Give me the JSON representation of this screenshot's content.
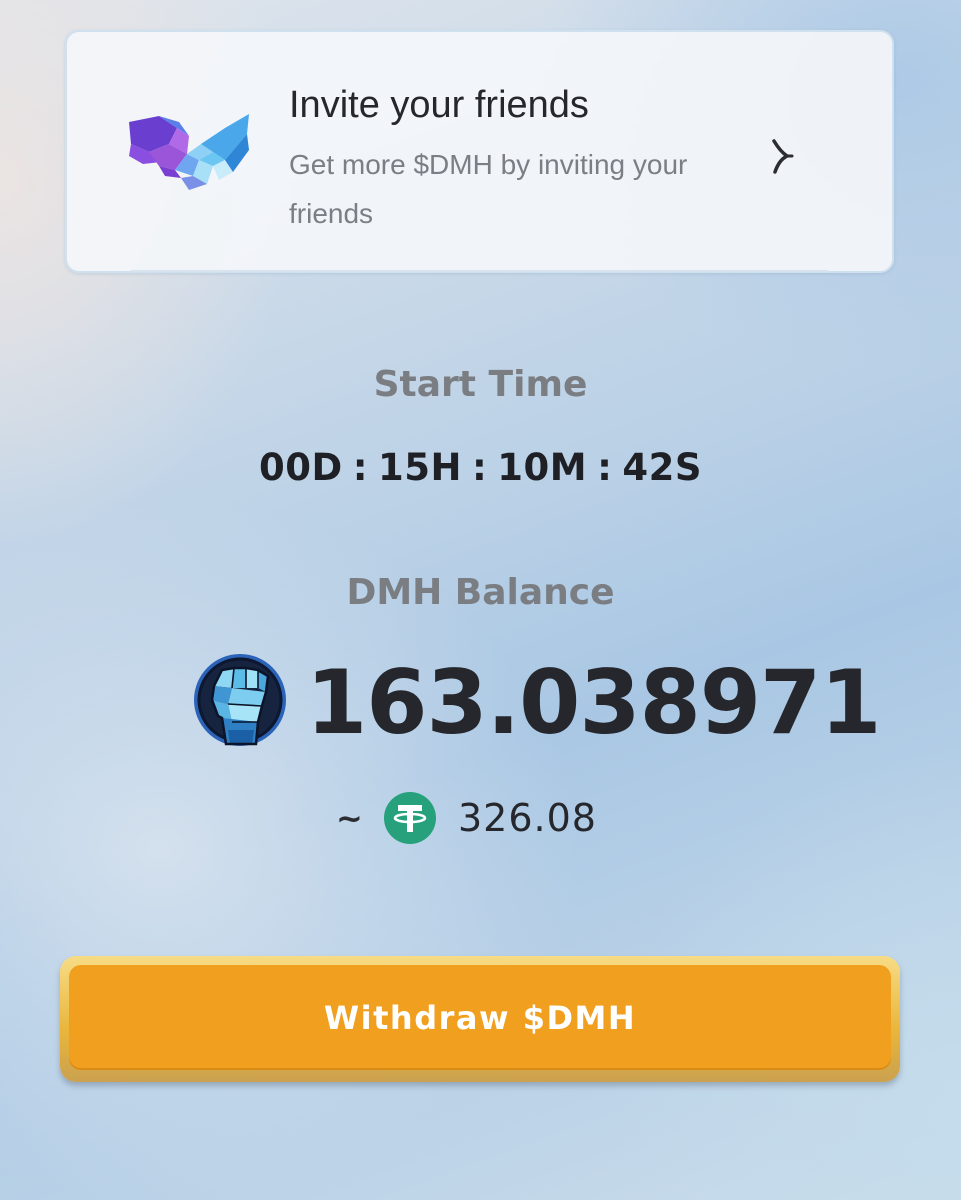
{
  "invite": {
    "title": "Invite your friends",
    "subtitle": "Get more $DMH by inviting your friends",
    "image": "handshake-image",
    "chevron_icon": "chevron-right-icon"
  },
  "timer": {
    "label": "Start Time",
    "days": "00D",
    "hours": "15H",
    "minutes": "10M",
    "seconds": "42S",
    "separator": ":"
  },
  "balance": {
    "label": "DMH Balance",
    "amount": "163.038971",
    "token_icon": "fist-coin-icon",
    "approx_symbol": "~",
    "usdt_icon": "tether-icon",
    "usdt_value": "326.08"
  },
  "withdraw": {
    "label": "Withdraw $DMH"
  },
  "colors": {
    "button": "#f19f1e",
    "tether": "#26a17b",
    "label_gray": "#7a7d82"
  }
}
